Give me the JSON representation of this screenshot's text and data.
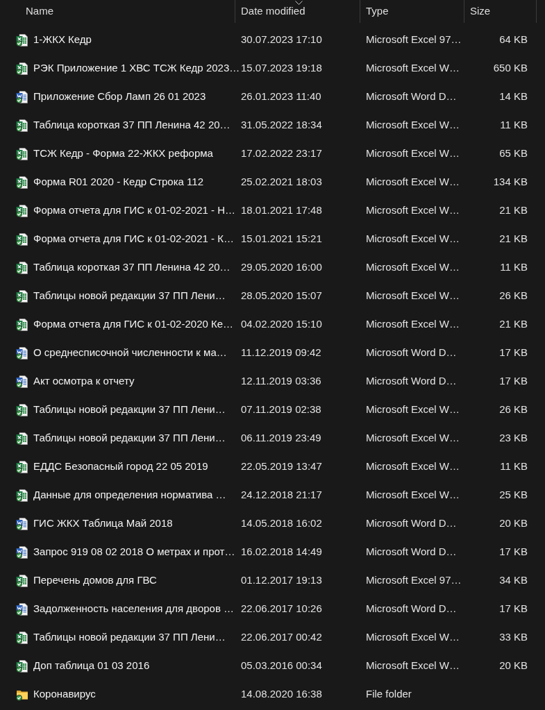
{
  "columns": [
    {
      "label": "Name",
      "sorted": false
    },
    {
      "label": "Date modified",
      "sorted": true
    },
    {
      "label": "Type",
      "sorted": false
    },
    {
      "label": "Size",
      "sorted": false
    }
  ],
  "files": [
    {
      "kind": "excel",
      "name": "1-ЖКХ Кедр",
      "date_modified": "30.07.2023 17:10",
      "type": "Microsoft Excel 97…",
      "size": "64 KB"
    },
    {
      "kind": "excel",
      "name": "РЭК Приложение 1 ХВС ТСЖ Кедр 2023…",
      "date_modified": "15.07.2023 19:18",
      "type": "Microsoft Excel W…",
      "size": "650 KB"
    },
    {
      "kind": "word",
      "name": "Приложение Сбор Ламп 26 01 2023",
      "date_modified": "26.01.2023 11:40",
      "type": "Microsoft Word D…",
      "size": "14 KB"
    },
    {
      "kind": "excel",
      "name": "Таблица короткая 37 ПП Ленина 42 20…",
      "date_modified": "31.05.2022 18:34",
      "type": "Microsoft Excel W…",
      "size": "11 KB"
    },
    {
      "kind": "excel",
      "name": "ТСЖ Кедр - Форма 22-ЖКХ реформа",
      "date_modified": "17.02.2022 23:17",
      "type": "Microsoft Excel W…",
      "size": "65 KB"
    },
    {
      "kind": "excel",
      "name": "Форма R01 2020 - Кедр Строка 112",
      "date_modified": "25.02.2021 18:03",
      "type": "Microsoft Excel W…",
      "size": "134 KB"
    },
    {
      "kind": "excel",
      "name": "Форма отчета для ГИС к 01-02-2021 - Н…",
      "date_modified": "18.01.2021 17:48",
      "type": "Microsoft Excel W…",
      "size": "21 KB"
    },
    {
      "kind": "excel",
      "name": "Форма отчета для ГИС к 01-02-2021 - К…",
      "date_modified": "15.01.2021 15:21",
      "type": "Microsoft Excel W…",
      "size": "21 KB"
    },
    {
      "kind": "excel",
      "name": "Таблица короткая 37 ПП Ленина 42 20…",
      "date_modified": "29.05.2020 16:00",
      "type": "Microsoft Excel W…",
      "size": "11 KB"
    },
    {
      "kind": "excel",
      "name": "Таблицы новой редакции 37 ПП Лени…",
      "date_modified": "28.05.2020 15:07",
      "type": "Microsoft Excel W…",
      "size": "26 KB"
    },
    {
      "kind": "excel",
      "name": "Форма отчета для ГИС к 01-02-2020 Ке…",
      "date_modified": "04.02.2020 15:10",
      "type": "Microsoft Excel W…",
      "size": "21 KB"
    },
    {
      "kind": "word",
      "name": "О среднесписочной численности к ма…",
      "date_modified": "11.12.2019 09:42",
      "type": "Microsoft Word D…",
      "size": "17 KB"
    },
    {
      "kind": "word",
      "name": "Акт осмотра к отчету",
      "date_modified": "12.11.2019 03:36",
      "type": "Microsoft Word D…",
      "size": "17 KB"
    },
    {
      "kind": "excel",
      "name": "Таблицы новой редакции 37 ПП Лени…",
      "date_modified": "07.11.2019 02:38",
      "type": "Microsoft Excel W…",
      "size": "26 KB"
    },
    {
      "kind": "excel",
      "name": "Таблицы новой редакции 37 ПП Лени…",
      "date_modified": "06.11.2019 23:49",
      "type": "Microsoft Excel W…",
      "size": "23 KB"
    },
    {
      "kind": "excel",
      "name": "ЕДДС Безопасный город 22 05 2019",
      "date_modified": "22.05.2019 13:47",
      "type": "Microsoft Excel W…",
      "size": "11 KB"
    },
    {
      "kind": "excel",
      "name": "Данные для определения норматива …",
      "date_modified": "24.12.2018 21:17",
      "type": "Microsoft Excel W…",
      "size": "25 KB"
    },
    {
      "kind": "word",
      "name": "ГИС ЖКХ Таблица Май 2018",
      "date_modified": "14.05.2018 16:02",
      "type": "Microsoft Word D…",
      "size": "20 KB"
    },
    {
      "kind": "word",
      "name": "Запрос 919 08 02 2018 О метрах и прот…",
      "date_modified": "16.02.2018 14:49",
      "type": "Microsoft Word D…",
      "size": "17 KB"
    },
    {
      "kind": "excel",
      "name": "Перечень домов для ГВС",
      "date_modified": "01.12.2017 19:13",
      "type": "Microsoft Excel 97…",
      "size": "34 KB"
    },
    {
      "kind": "word",
      "name": "Задолженность населения для дворов …",
      "date_modified": "22.06.2017 10:26",
      "type": "Microsoft Word D…",
      "size": "17 KB"
    },
    {
      "kind": "excel",
      "name": "Таблицы новой редакции 37 ПП Лени…",
      "date_modified": "22.06.2017 00:42",
      "type": "Microsoft Excel W…",
      "size": "33 KB"
    },
    {
      "kind": "excel",
      "name": "Доп таблица 01 03 2016",
      "date_modified": "05.03.2016 00:34",
      "type": "Microsoft Excel W…",
      "size": "20 KB"
    },
    {
      "kind": "folder",
      "name": "Коронавирус",
      "date_modified": "14.08.2020 16:38",
      "type": "File folder"
    }
  ]
}
